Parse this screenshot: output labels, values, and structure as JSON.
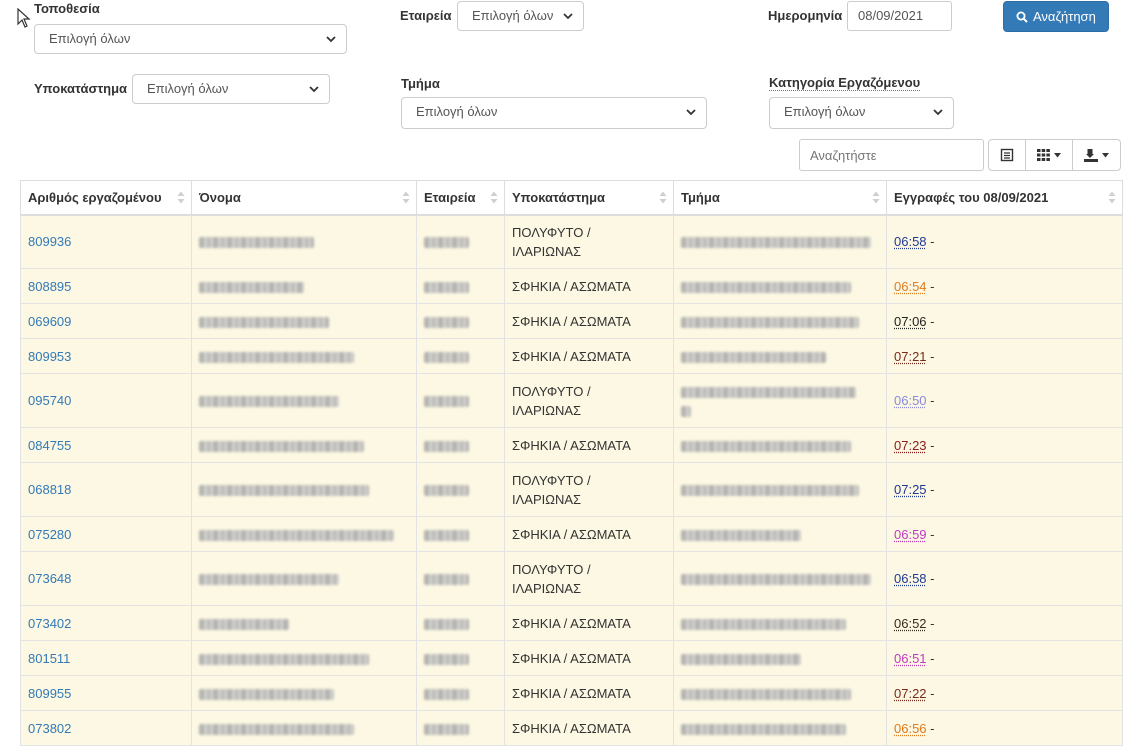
{
  "filters": {
    "location_label": "Τοποθεσία",
    "location_value": "Επιλογή όλων",
    "company_label": "Εταιρεία",
    "company_value": "Επιλογή όλων",
    "date_label": "Ημερομηνία",
    "date_value": "08/09/2021",
    "search_button": "Αναζήτηση",
    "branch_label": "Υποκατάστημα",
    "branch_value": "Επιλογή όλων",
    "department_label": "Τμήμα",
    "department_value": "Επιλογή όλων",
    "category_label": "Κατηγορία Εργαζόμενου",
    "category_value": "Επιλογή όλων"
  },
  "toolbar": {
    "search_placeholder": "Αναζητήστε"
  },
  "colors": {
    "primary": "#337ab7",
    "row_bg": "#fcf8e3",
    "link": "#337ab7"
  },
  "table": {
    "columns": [
      "Αριθμός εργαζομένου",
      "Όνομα",
      "Εταιρεία",
      "Υποκατάστημα",
      "Τμήμα",
      "Εγγραφές του 08/09/2021"
    ],
    "rows": [
      {
        "id": "809936",
        "branch_l1": "ΠΟΛΥΦΥΤΟ /",
        "branch_l2": "ΙΛΑΡΙΩΝΑΣ",
        "time": "06:58",
        "suffix": " -",
        "time_color": "#1f3a93"
      },
      {
        "id": "808895",
        "branch_l1": "ΣΦΗΚΙΑ / ΑΣΩΜΑΤΑ",
        "branch_l2": "",
        "time": "06:54",
        "suffix": " -",
        "time_color": "#e07b1f"
      },
      {
        "id": "069609",
        "branch_l1": "ΣΦΗΚΙΑ / ΑΣΩΜΑΤΑ",
        "branch_l2": "",
        "time": "07:06",
        "suffix": " -",
        "time_color": "#222222"
      },
      {
        "id": "809953",
        "branch_l1": "ΣΦΗΚΙΑ / ΑΣΩΜΑΤΑ",
        "branch_l2": "",
        "time": "07:21",
        "suffix": " -",
        "time_color": "#7a2a1a"
      },
      {
        "id": "095740",
        "branch_l1": "ΠΟΛΥΦΥΤΟ /",
        "branch_l2": "ΙΛΑΡΙΩΝΑΣ",
        "time": "06:50",
        "suffix": " -",
        "time_color": "#8a8ad8"
      },
      {
        "id": "084755",
        "branch_l1": "ΣΦΗΚΙΑ / ΑΣΩΜΑΤΑ",
        "branch_l2": "",
        "time": "07:23",
        "suffix": " -",
        "time_color": "#8b1a1a"
      },
      {
        "id": "068818",
        "branch_l1": "ΠΟΛΥΦΥΤΟ /",
        "branch_l2": "ΙΛΑΡΙΩΝΑΣ",
        "time": "07:25",
        "suffix": " -",
        "time_color": "#1f3a93"
      },
      {
        "id": "075280",
        "branch_l1": "ΣΦΗΚΙΑ / ΑΣΩΜΑΤΑ",
        "branch_l2": "",
        "time": "06:59",
        "suffix": " -",
        "time_color": "#c03ac0"
      },
      {
        "id": "073648",
        "branch_l1": "ΠΟΛΥΦΥΤΟ /",
        "branch_l2": "ΙΛΑΡΙΩΝΑΣ",
        "time": "06:58",
        "suffix": " -",
        "time_color": "#1f3a93"
      },
      {
        "id": "073402",
        "branch_l1": "ΣΦΗΚΙΑ / ΑΣΩΜΑΤΑ",
        "branch_l2": "",
        "time": "06:52",
        "suffix": " -",
        "time_color": "#3a2a1a"
      },
      {
        "id": "801511",
        "branch_l1": "ΣΦΗΚΙΑ / ΑΣΩΜΑΤΑ",
        "branch_l2": "",
        "time": "06:51",
        "suffix": " -",
        "time_color": "#c03ac0"
      },
      {
        "id": "809955",
        "branch_l1": "ΣΦΗΚΙΑ / ΑΣΩΜΑΤΑ",
        "branch_l2": "",
        "time": "07:22",
        "suffix": " -",
        "time_color": "#7a2a1a"
      },
      {
        "id": "073802",
        "branch_l1": "ΣΦΗΚΙΑ / ΑΣΩΜΑΤΑ",
        "branch_l2": "",
        "time": "06:56",
        "suffix": " -",
        "time_color": "#e07b1f"
      }
    ]
  }
}
